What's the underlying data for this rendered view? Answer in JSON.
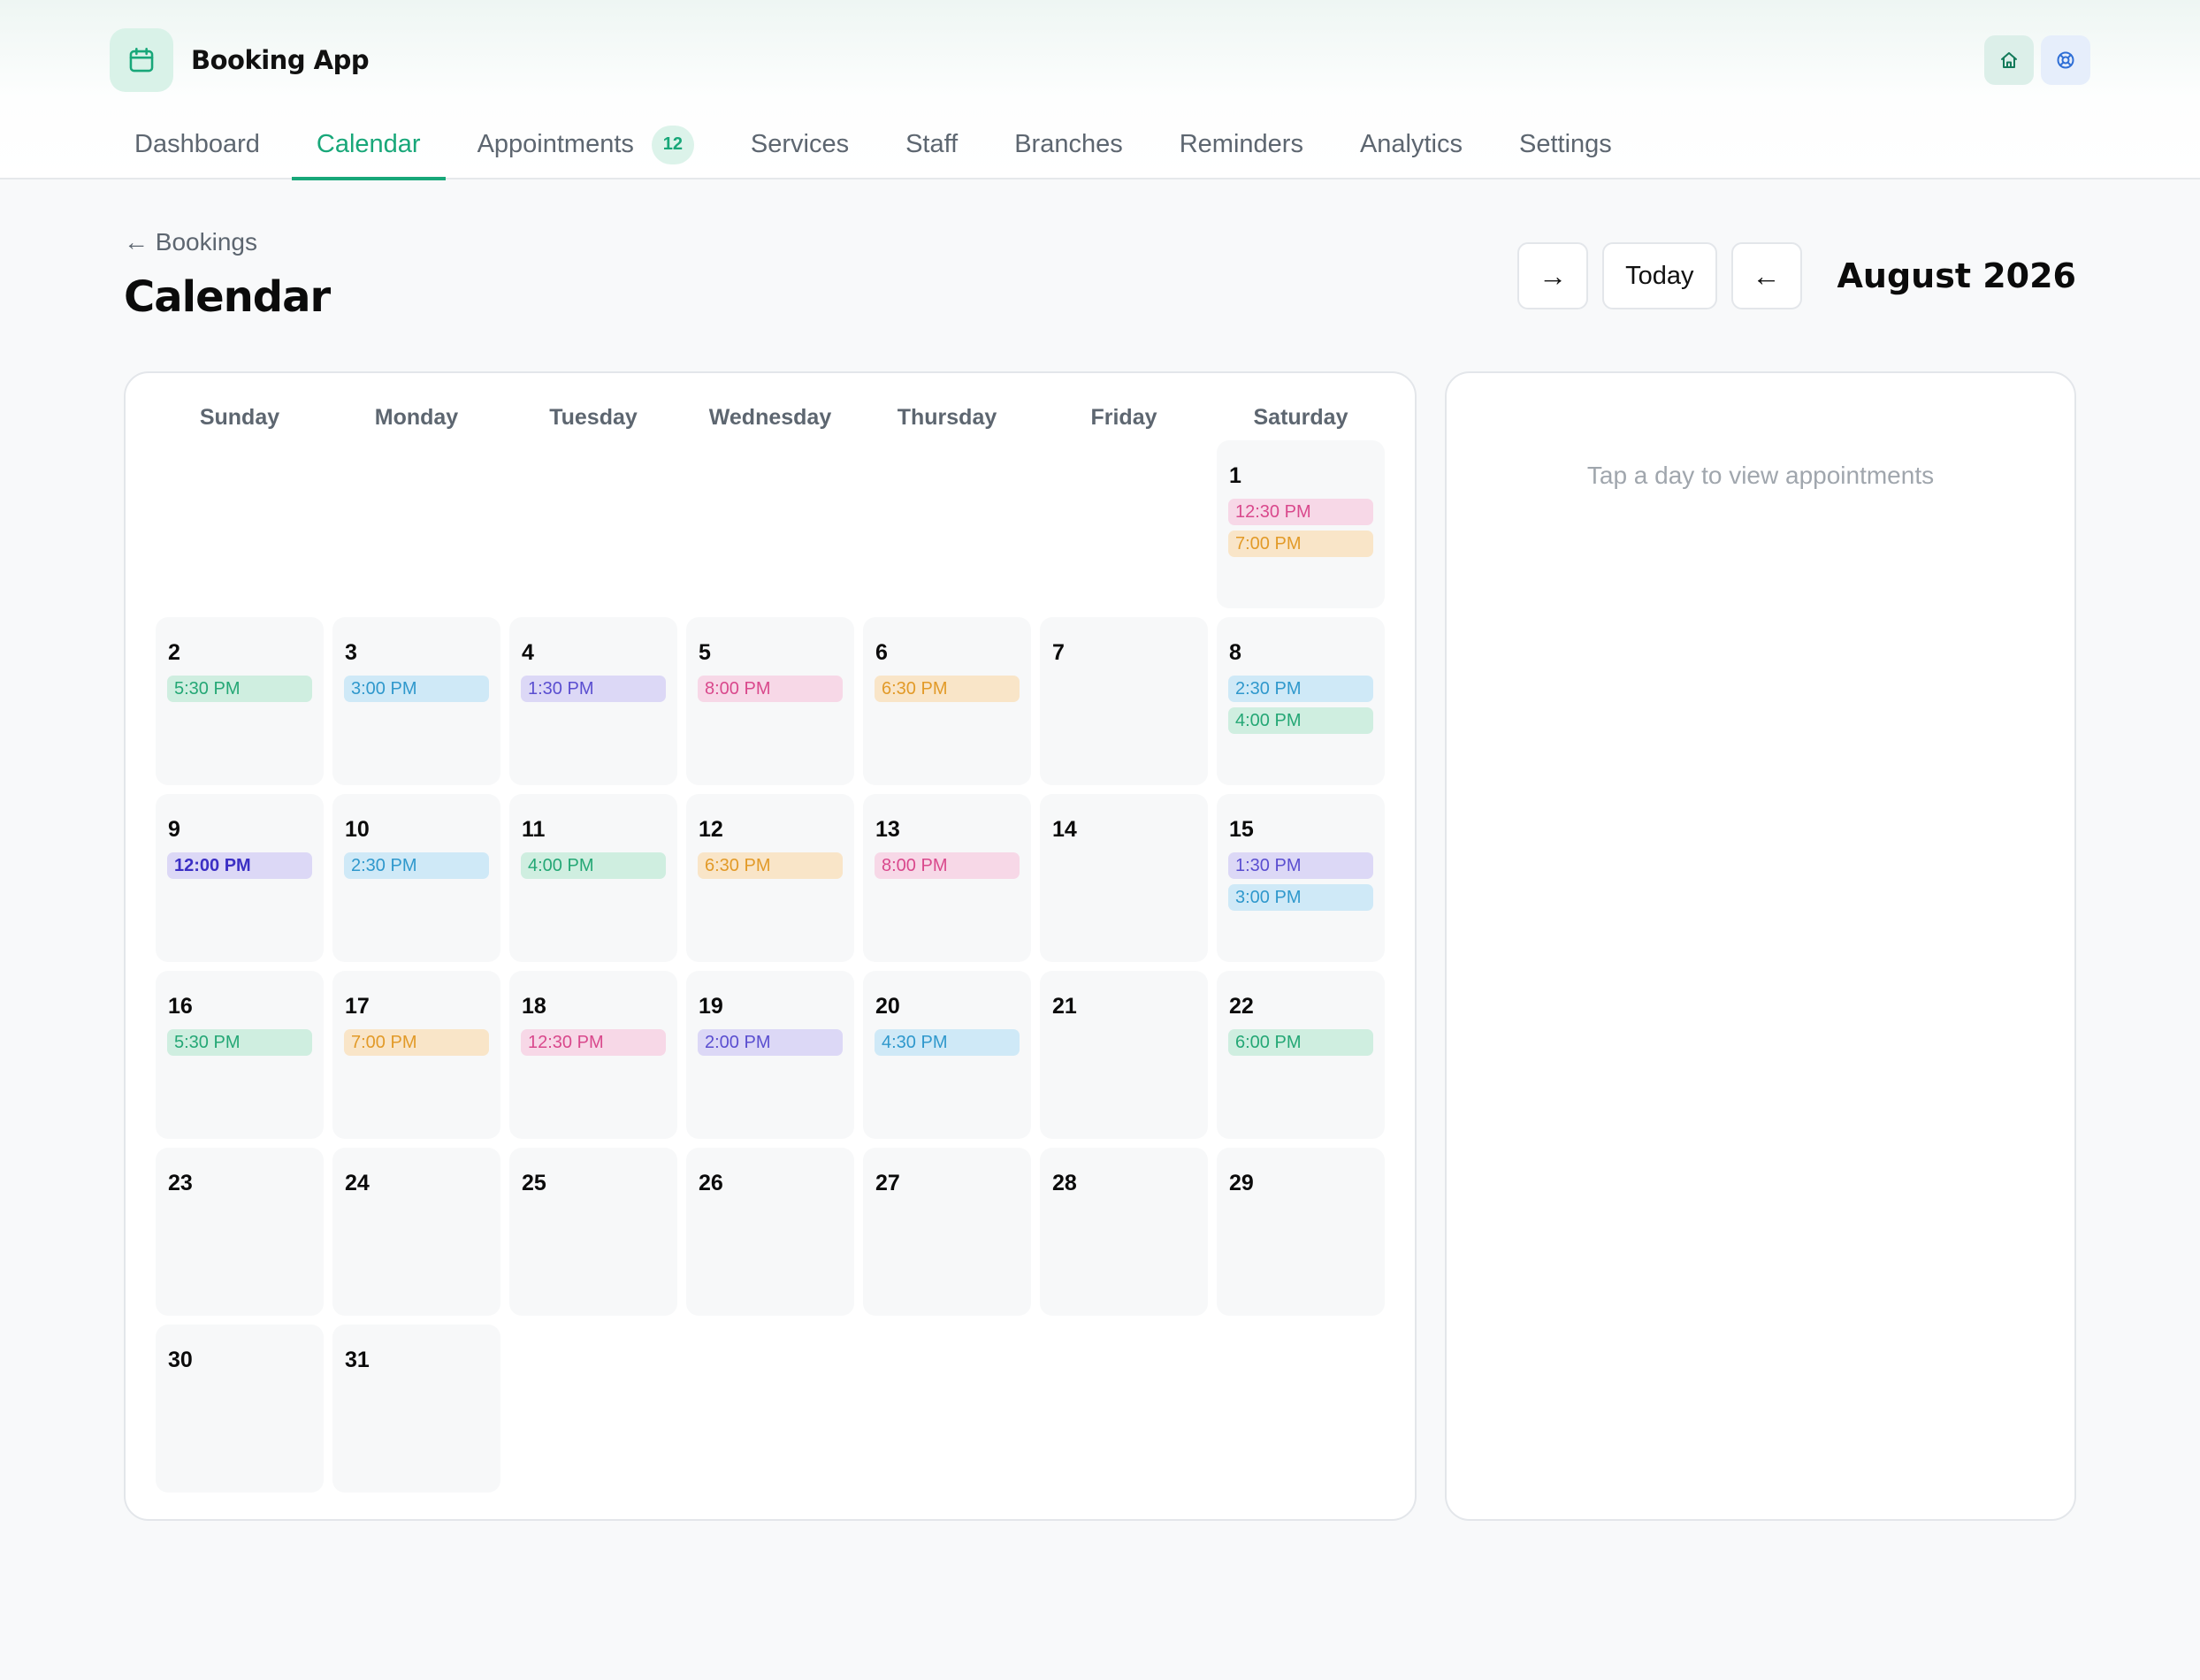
{
  "app": {
    "name": "Booking App"
  },
  "nav": {
    "items": [
      {
        "label": "Dashboard"
      },
      {
        "label": "Calendar",
        "active": true
      },
      {
        "label": "Appointments",
        "badge": "12"
      },
      {
        "label": "Services"
      },
      {
        "label": "Staff"
      },
      {
        "label": "Branches"
      },
      {
        "label": "Reminders"
      },
      {
        "label": "Analytics"
      },
      {
        "label": "Settings"
      }
    ]
  },
  "header_icons": [
    "home-icon",
    "help-icon"
  ],
  "page": {
    "back_label": "← Bookings",
    "title": "Calendar",
    "month_label": "August 2026",
    "next_label": "→",
    "today_label": "Today",
    "prev_label": "←"
  },
  "calendar": {
    "weekdays": [
      "Sunday",
      "Monday",
      "Tuesday",
      "Wednesday",
      "Thursday",
      "Friday",
      "Saturday"
    ],
    "leading_blanks": 6,
    "days": [
      {
        "day": "1",
        "events": [
          {
            "time": "12:30 PM",
            "color": "pink"
          },
          {
            "time": "7:00 PM",
            "color": "orange"
          }
        ]
      },
      {
        "day": "2",
        "events": [
          {
            "time": "5:30 PM",
            "color": "green"
          }
        ]
      },
      {
        "day": "3",
        "events": [
          {
            "time": "3:00 PM",
            "color": "blue"
          }
        ]
      },
      {
        "day": "4",
        "events": [
          {
            "time": "1:30 PM",
            "color": "purple"
          }
        ]
      },
      {
        "day": "5",
        "events": [
          {
            "time": "8:00 PM",
            "color": "pink"
          }
        ]
      },
      {
        "day": "6",
        "events": [
          {
            "time": "6:30 PM",
            "color": "orange"
          }
        ]
      },
      {
        "day": "7",
        "events": []
      },
      {
        "day": "8",
        "events": [
          {
            "time": "2:30 PM",
            "color": "blue"
          },
          {
            "time": "4:00 PM",
            "color": "green"
          }
        ]
      },
      {
        "day": "9",
        "events": [
          {
            "time": "12:00 PM",
            "color": "purple",
            "strong": true
          }
        ]
      },
      {
        "day": "10",
        "events": [
          {
            "time": "2:30 PM",
            "color": "blue"
          }
        ]
      },
      {
        "day": "11",
        "events": [
          {
            "time": "4:00 PM",
            "color": "green"
          }
        ]
      },
      {
        "day": "12",
        "events": [
          {
            "time": "6:30 PM",
            "color": "orange"
          }
        ]
      },
      {
        "day": "13",
        "events": [
          {
            "time": "8:00 PM",
            "color": "pink"
          }
        ]
      },
      {
        "day": "14",
        "events": []
      },
      {
        "day": "15",
        "events": [
          {
            "time": "1:30 PM",
            "color": "purple"
          },
          {
            "time": "3:00 PM",
            "color": "blue"
          }
        ]
      },
      {
        "day": "16",
        "events": [
          {
            "time": "5:30 PM",
            "color": "green"
          }
        ]
      },
      {
        "day": "17",
        "events": [
          {
            "time": "7:00 PM",
            "color": "orange"
          }
        ]
      },
      {
        "day": "18",
        "events": [
          {
            "time": "12:30 PM",
            "color": "pink"
          }
        ]
      },
      {
        "day": "19",
        "events": [
          {
            "time": "2:00 PM",
            "color": "purple"
          }
        ]
      },
      {
        "day": "20",
        "events": [
          {
            "time": "4:30 PM",
            "color": "blue"
          }
        ]
      },
      {
        "day": "21",
        "events": []
      },
      {
        "day": "22",
        "events": [
          {
            "time": "6:00 PM",
            "color": "green"
          }
        ]
      },
      {
        "day": "23",
        "events": []
      },
      {
        "day": "24",
        "events": []
      },
      {
        "day": "25",
        "events": []
      },
      {
        "day": "26",
        "events": []
      },
      {
        "day": "27",
        "events": []
      },
      {
        "day": "28",
        "events": []
      },
      {
        "day": "29",
        "events": []
      },
      {
        "day": "30",
        "events": []
      },
      {
        "day": "31",
        "events": []
      }
    ]
  },
  "side_panel": {
    "empty_text": "Tap a day to view appointments"
  },
  "colors": {
    "accent": "#18a779",
    "pink": "#d9488c",
    "orange": "#e29a28",
    "green": "#24a775",
    "blue": "#2f98cc",
    "purple": "#5a4ed0"
  }
}
